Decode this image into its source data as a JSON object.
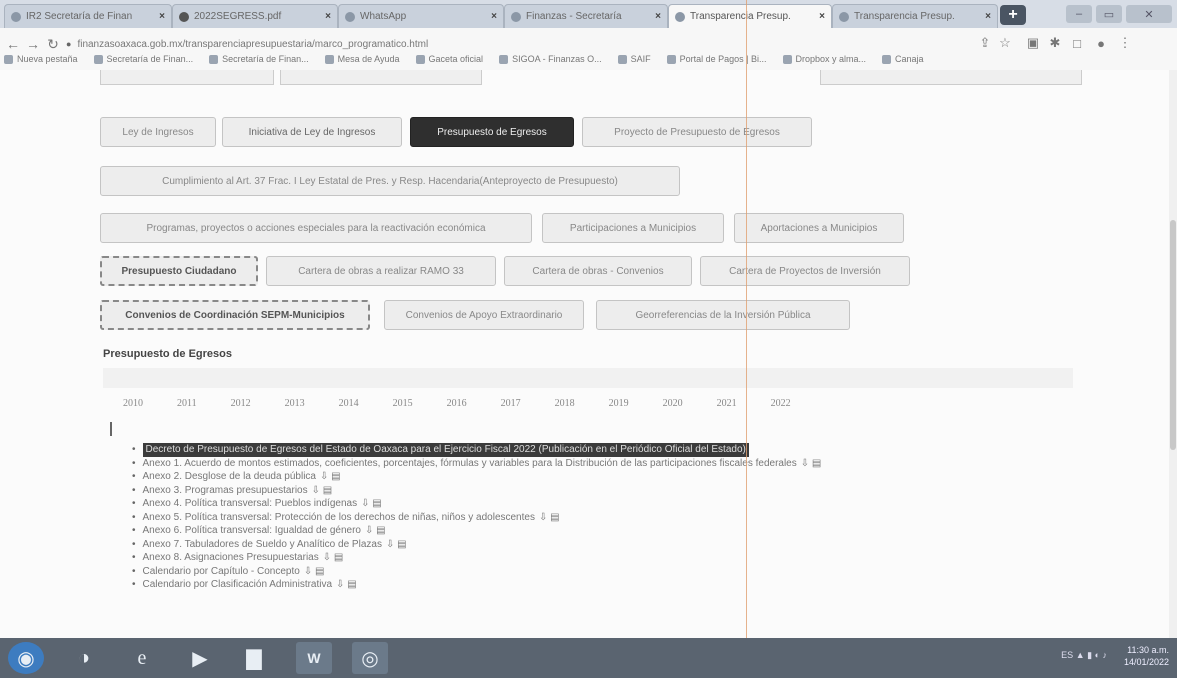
{
  "browser": {
    "tabs": [
      {
        "label": "IR2 Secretaría de Finan",
        "active": false
      },
      {
        "label": "2022SEGRESS.pdf",
        "active": false
      },
      {
        "label": "WhatsApp",
        "active": false
      },
      {
        "label": "Finanzas - Secretaría",
        "active": false
      },
      {
        "label": "Transparencia Presup.",
        "active": true
      },
      {
        "label": "Transparencia Presup.",
        "active": false
      }
    ],
    "url": "finanzasoaxaca.gob.mx/transparenciapresupuestaria/marco_programatico.html",
    "bookmarks": [
      "Nueva pestaña",
      "Secretaría de Finan...",
      "Secretaría de Finan...",
      "Mesa de Ayuda",
      "Gaceta oficial",
      "SIGOA - Finanzas O...",
      "SAIF",
      "Portal de Pagos | Bi...",
      "Dropbox y alma...",
      "Canaja"
    ]
  },
  "page": {
    "buttons_row1": [
      "Ley de Ingresos",
      "Iniciativa de Ley de Ingresos",
      "Presupuesto de Egresos",
      "Proyecto de Presupuesto de Egresos"
    ],
    "buttons_row2": [
      "Cumplimiento al Art. 37 Frac. I Ley Estatal de Pres. y Resp. Hacendaria(Anteproyecto de Presupuesto)"
    ],
    "buttons_row3": [
      "Programas, proyectos o acciones especiales para la reactivación económica",
      "Participaciones a Municipios",
      "Aportaciones a Municipios"
    ],
    "buttons_row4": [
      "Presupuesto Ciudadano",
      "Cartera de obras a realizar RAMO 33",
      "Cartera de obras - Convenios",
      "Cartera de Proyectos de Inversión"
    ],
    "buttons_row5": [
      "Convenios de Coordinación SEPM-Municipios",
      "Convenios de Apoyo Extraordinario",
      "Georreferencias de la Inversión Pública"
    ],
    "section_title": "Presupuesto de Egresos",
    "years": [
      "2010",
      "2011",
      "2012",
      "2013",
      "2014",
      "2015",
      "2016",
      "2017",
      "2018",
      "2019",
      "2020",
      "2021",
      "2022"
    ],
    "documents": [
      "Decreto de Presupuesto de Egresos del Estado de Oaxaca para el Ejercicio Fiscal 2022 (Publicación en el Periódico Oficial del Estado)",
      "Anexo 1. Acuerdo de montos estimados, coeficientes, porcentajes, fórmulas y variables para la Distribución de las participaciones fiscales federales",
      "Anexo 2. Desglose de la deuda pública",
      "Anexo 3. Programas presupuestarios",
      "Anexo 4. Política transversal: Pueblos indígenas",
      "Anexo 5. Política transversal: Protección de los derechos de niñas, niños y adolescentes",
      "Anexo 6. Política transversal: Igualdad de género",
      "Anexo 7. Tabuladores de Sueldo y Analítico de Plazas",
      "Anexo 8. Asignaciones Presupuestarias",
      "Calendario por Capítulo - Concepto",
      "Calendario por Clasificación Administrativa"
    ]
  },
  "taskbar": {
    "apps": [
      "start",
      "edge-ie",
      "media",
      "files",
      "word",
      "chrome"
    ],
    "time": "11:30 a.m.",
    "date": "14/01/2022",
    "lang": "ES"
  }
}
